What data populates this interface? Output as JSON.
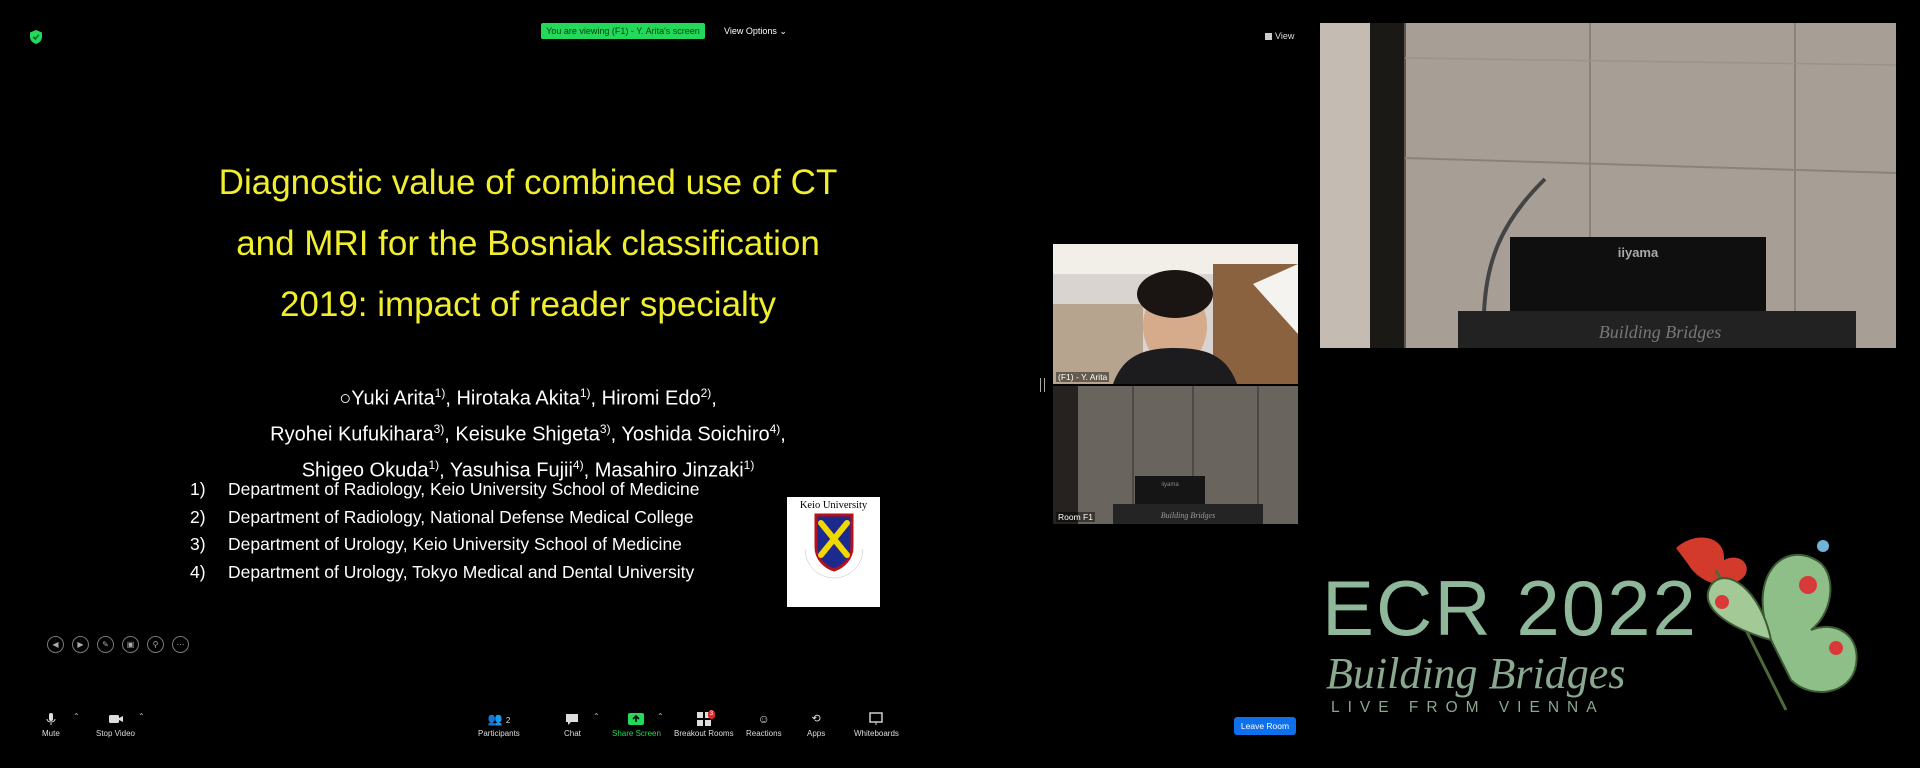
{
  "topbar": {
    "viewing_banner": "You are viewing (F1) - Y. Arita's screen",
    "view_options": "View Options ⌄",
    "view_label": "View"
  },
  "slide": {
    "title_lines": [
      "Diagnostic value of combined use of CT",
      "and MRI for the Bosniak classification",
      "2019: impact of reader specialty"
    ],
    "authors": [
      [
        [
          "○Yuki Arita",
          "1)"
        ],
        [
          ", Hirotaka Akita",
          "1)"
        ],
        [
          ", Hiromi Edo",
          "2)"
        ],
        [
          ",",
          ""
        ]
      ],
      [
        [
          "Ryohei Kufukihara",
          "3)"
        ],
        [
          ", Keisuke Shigeta",
          "3)"
        ],
        [
          ", Yoshida Soichiro",
          "4)"
        ],
        [
          ",",
          ""
        ]
      ],
      [
        [
          "Shigeo Okuda",
          "1)"
        ],
        [
          ", Yasuhisa Fujii",
          "4)"
        ],
        [
          ", Masahiro Jinzaki",
          "1)"
        ]
      ]
    ],
    "affiliations": [
      {
        "num": "1)",
        "text": "Department of Radiology, Keio University School of Medicine"
      },
      {
        "num": "2)",
        "text": "Department of Radiology, National Defense Medical College"
      },
      {
        "num": "3)",
        "text": "Department of Urology, Keio University School of Medicine"
      },
      {
        "num": "4)",
        "text": "Department of Urology, Tokyo Medical and Dental University"
      }
    ],
    "logo": {
      "university": "Keio University",
      "year": "1858",
      "motto": "CALAMVS GLADIO FORTIOR"
    }
  },
  "thumbnails": {
    "speaker_label": "(F1) - Y. Arita",
    "room_label": "Room F1",
    "monitor_brand": "iiyama",
    "podium_text": "Building Bridges"
  },
  "room_camera": {
    "monitor_brand": "iiyama",
    "podium_text": "Building Bridges"
  },
  "ecr": {
    "title": "ECR 2022",
    "subtitle": "Building Bridges",
    "tagline": "LIVE FROM VIENNA"
  },
  "toolbar": {
    "mute": "Mute",
    "stop_video": "Stop Video",
    "participants": "Participants",
    "participants_count": "2",
    "chat": "Chat",
    "share_screen": "Share Screen",
    "breakout_rooms": "Breakout Rooms",
    "breakout_badge": "3",
    "reactions": "Reactions",
    "apps": "Apps",
    "whiteboards": "Whiteboards",
    "leave_room": "Leave Room"
  },
  "colors": {
    "slide_title": "#f0ee2d",
    "banner": "#23d959",
    "share_screen": "#23d959",
    "leave": "#0e71eb"
  }
}
